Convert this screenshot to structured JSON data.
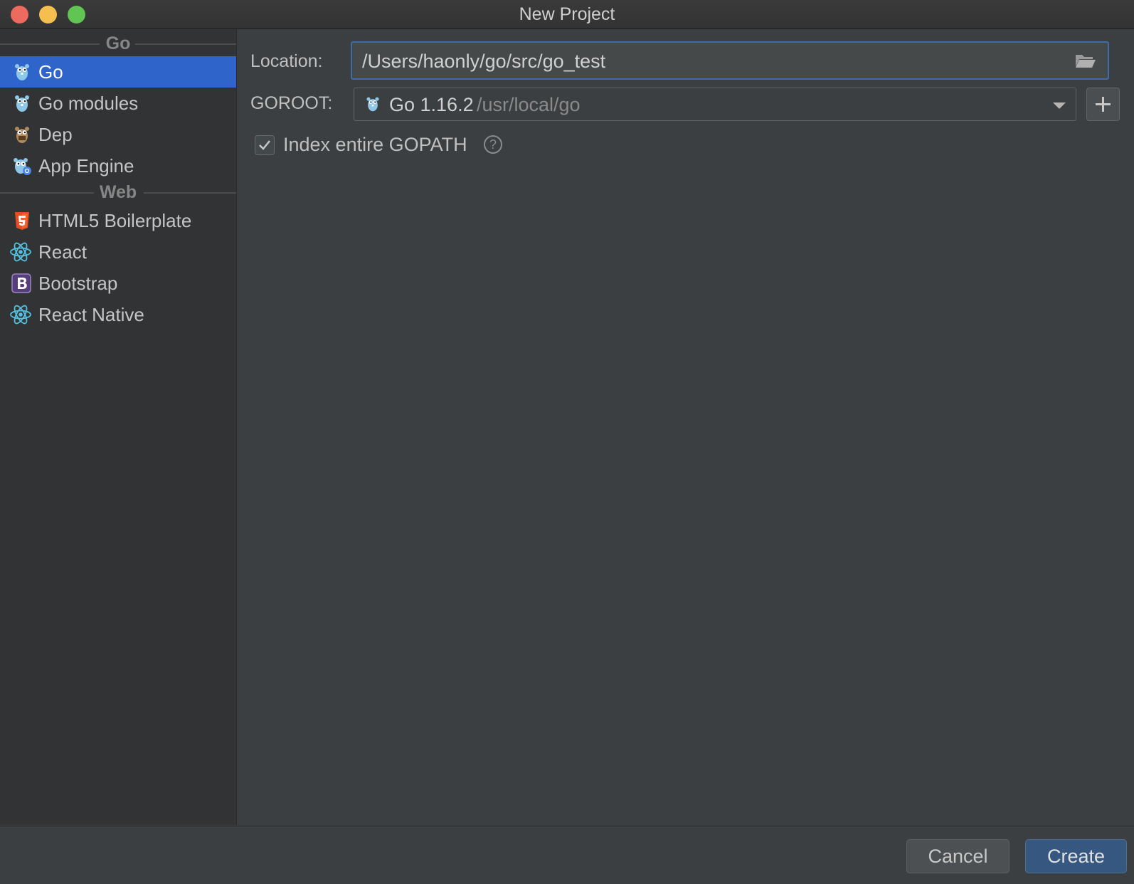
{
  "window": {
    "title": "New Project"
  },
  "sidebar": {
    "groups": [
      {
        "header": "Go",
        "items": [
          {
            "label": "Go",
            "icon": "gopher-icon",
            "selected": true
          },
          {
            "label": "Go modules",
            "icon": "gopher-icon"
          },
          {
            "label": "Dep",
            "icon": "dep-icon"
          },
          {
            "label": "App Engine",
            "icon": "app-engine-icon"
          }
        ]
      },
      {
        "header": "Web",
        "items": [
          {
            "label": "HTML5 Boilerplate",
            "icon": "html5-icon"
          },
          {
            "label": "React",
            "icon": "react-icon"
          },
          {
            "label": "Bootstrap",
            "icon": "bootstrap-icon"
          },
          {
            "label": "React Native",
            "icon": "react-icon"
          }
        ]
      }
    ]
  },
  "form": {
    "location_label": "Location:",
    "location_value": "/Users/haonly/go/src/go_test",
    "goroot_label": "GOROOT:",
    "goroot_version": "Go 1.16.2",
    "goroot_path": "/usr/local/go",
    "index_gopath_label": "Index entire GOPATH",
    "index_gopath_checked": true
  },
  "footer": {
    "cancel_label": "Cancel",
    "create_label": "Create"
  },
  "colors": {
    "selection": "#2f65ca",
    "primary_button": "#365880",
    "focus_border": "#3d6ea7"
  }
}
